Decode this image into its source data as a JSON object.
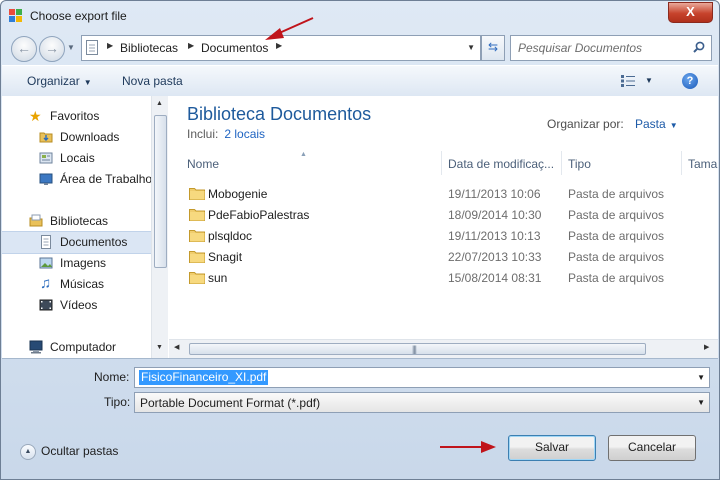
{
  "window": {
    "title": "Choose export file",
    "close_glyph": "X"
  },
  "navigation": {
    "back_glyph": "←",
    "forward_glyph": "→",
    "breadcrumbs": [
      "Bibliotecas",
      "Documentos"
    ],
    "refresh_glyph": "⇆",
    "search_placeholder": "Pesquisar Documentos"
  },
  "toolbar": {
    "organize_label": "Organizar",
    "new_folder_label": "Nova pasta",
    "help_glyph": "?"
  },
  "sidebar": {
    "items": [
      {
        "label": "Favoritos",
        "icon": "star-icon"
      },
      {
        "label": "Downloads",
        "icon": "download-folder-icon"
      },
      {
        "label": "Locais",
        "icon": "places-icon"
      },
      {
        "label": "Área de Trabalho",
        "icon": "desktop-icon"
      },
      {
        "label": "Bibliotecas",
        "icon": "library-icon"
      },
      {
        "label": "Documentos",
        "icon": "document-icon",
        "selected": true
      },
      {
        "label": "Imagens",
        "icon": "images-icon"
      },
      {
        "label": "Músicas",
        "icon": "music-icon"
      },
      {
        "label": "Vídeos",
        "icon": "videos-icon"
      },
      {
        "label": "Computador",
        "icon": "computer-icon"
      }
    ]
  },
  "library": {
    "title": "Biblioteca Documentos",
    "includes_label": "Inclui:",
    "includes_link": "2 locais",
    "arrange_label": "Organizar por:",
    "arrange_value": "Pasta"
  },
  "columns": [
    "Nome",
    "Data de modificaç...",
    "Tipo",
    "Tama"
  ],
  "files": [
    {
      "name": "Mobogenie",
      "date": "19/11/2013 10:06",
      "type": "Pasta de arquivos"
    },
    {
      "name": "PdeFabioPalestras",
      "date": "18/09/2014 10:30",
      "type": "Pasta de arquivos"
    },
    {
      "name": "plsqldoc",
      "date": "19/11/2013 10:13",
      "type": "Pasta de arquivos"
    },
    {
      "name": "Snagit",
      "date": "22/07/2013 10:33",
      "type": "Pasta de arquivos"
    },
    {
      "name": "sun",
      "date": "15/08/2014 08:31",
      "type": "Pasta de arquivos"
    }
  ],
  "form": {
    "name_label": "Nome:",
    "name_value": "FisicoFinanceiro_XI.pdf",
    "type_label": "Tipo:",
    "type_value": "Portable Document Format (*.pdf)"
  },
  "footer": {
    "hide_folders_label": "Ocultar pastas",
    "save_label": "Salvar",
    "cancel_label": "Cancelar"
  },
  "colors": {
    "accent_blue": "#1e5a9c",
    "selection": "#3399ff",
    "annotation_arrow": "#c0141b"
  }
}
